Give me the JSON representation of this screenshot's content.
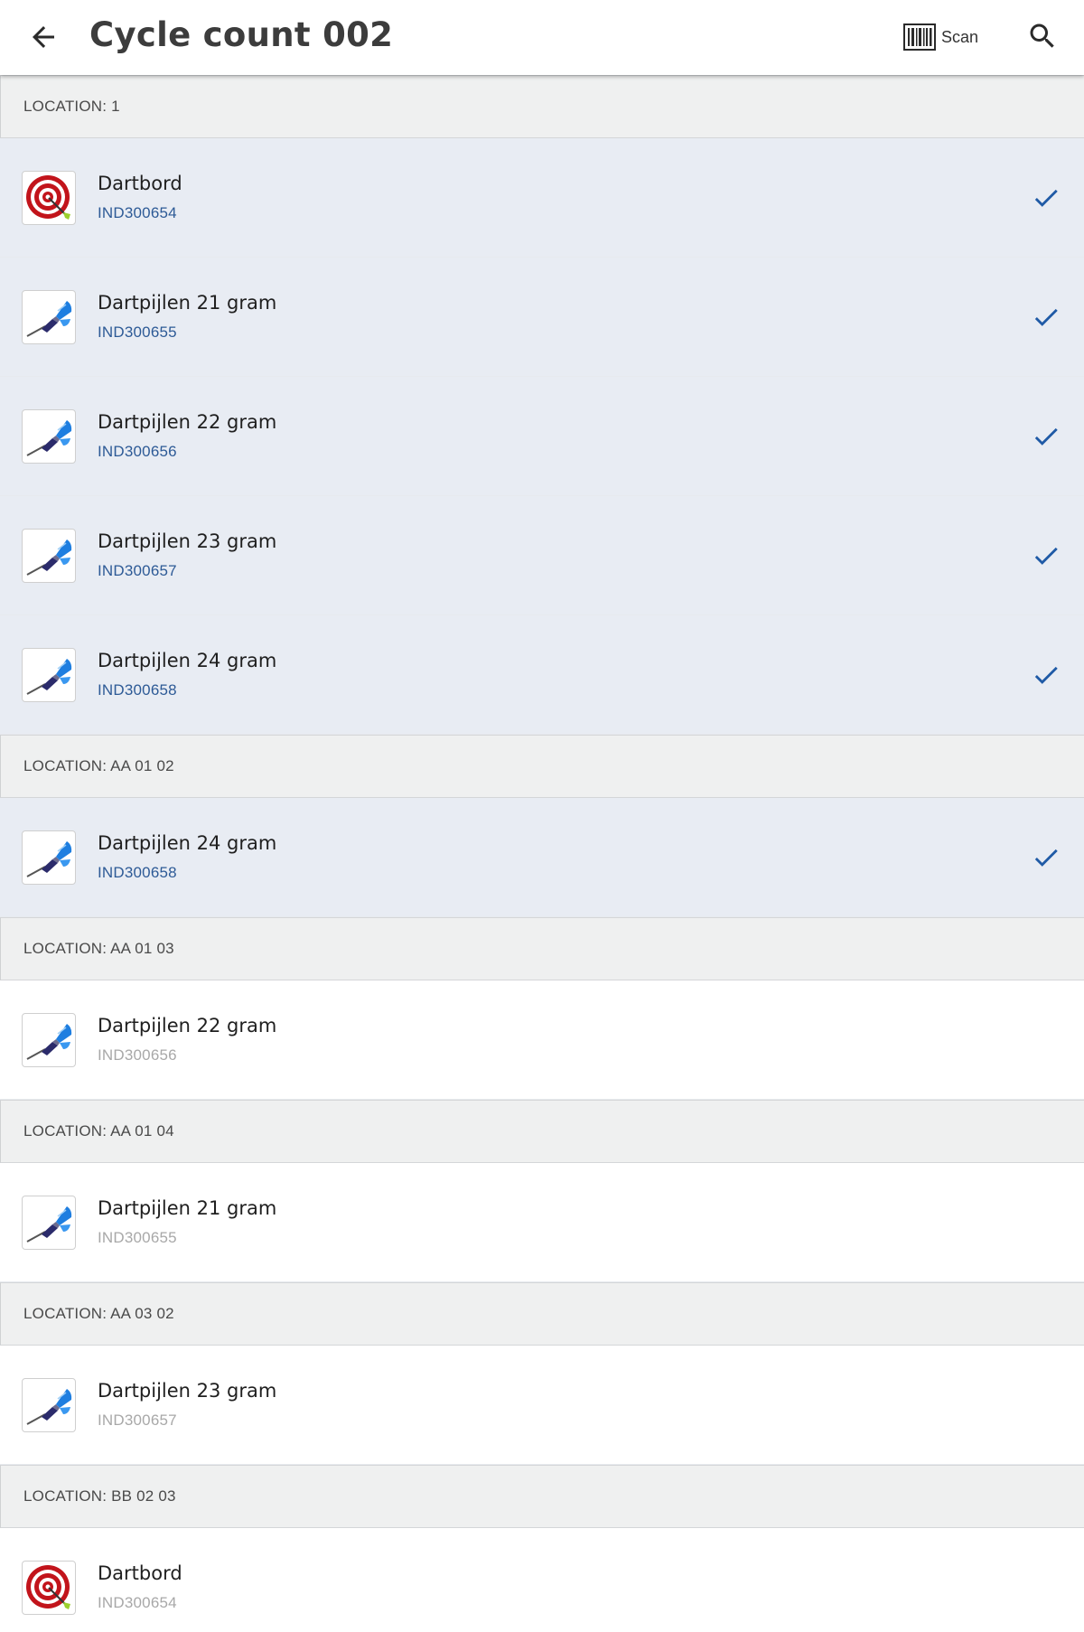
{
  "header": {
    "title": "Cycle count 002",
    "scan_label": "Scan"
  },
  "colors": {
    "accent": "#1f5aa6",
    "counted_row_bg": "#e8ecf3",
    "section_bg": "#eff0f0"
  },
  "sections": [
    {
      "label": "LOCATION: 1",
      "items": [
        {
          "name": "Dartbord",
          "code": "IND300654",
          "icon": "dartboard-icon",
          "counted": true
        },
        {
          "name": "Dartpijlen 21 gram",
          "code": "IND300655",
          "icon": "dart-icon",
          "counted": true
        },
        {
          "name": "Dartpijlen 22 gram",
          "code": "IND300656",
          "icon": "dart-icon",
          "counted": true
        },
        {
          "name": "Dartpijlen 23 gram",
          "code": "IND300657",
          "icon": "dart-icon",
          "counted": true
        },
        {
          "name": "Dartpijlen 24 gram",
          "code": "IND300658",
          "icon": "dart-icon",
          "counted": true
        }
      ]
    },
    {
      "label": "LOCATION: AA 01 02",
      "items": [
        {
          "name": "Dartpijlen 24 gram",
          "code": "IND300658",
          "icon": "dart-icon",
          "counted": true
        }
      ]
    },
    {
      "label": "LOCATION: AA 01 03",
      "items": [
        {
          "name": "Dartpijlen 22 gram",
          "code": "IND300656",
          "icon": "dart-icon",
          "counted": false
        }
      ]
    },
    {
      "label": "LOCATION: AA 01 04",
      "items": [
        {
          "name": "Dartpijlen 21 gram",
          "code": "IND300655",
          "icon": "dart-icon",
          "counted": false
        }
      ]
    },
    {
      "label": "LOCATION: AA 03 02",
      "items": [
        {
          "name": "Dartpijlen 23 gram",
          "code": "IND300657",
          "icon": "dart-icon",
          "counted": false
        }
      ]
    },
    {
      "label": "LOCATION: BB 02 03",
      "items": [
        {
          "name": "Dartbord",
          "code": "IND300654",
          "icon": "dartboard-icon",
          "counted": false
        }
      ]
    }
  ]
}
